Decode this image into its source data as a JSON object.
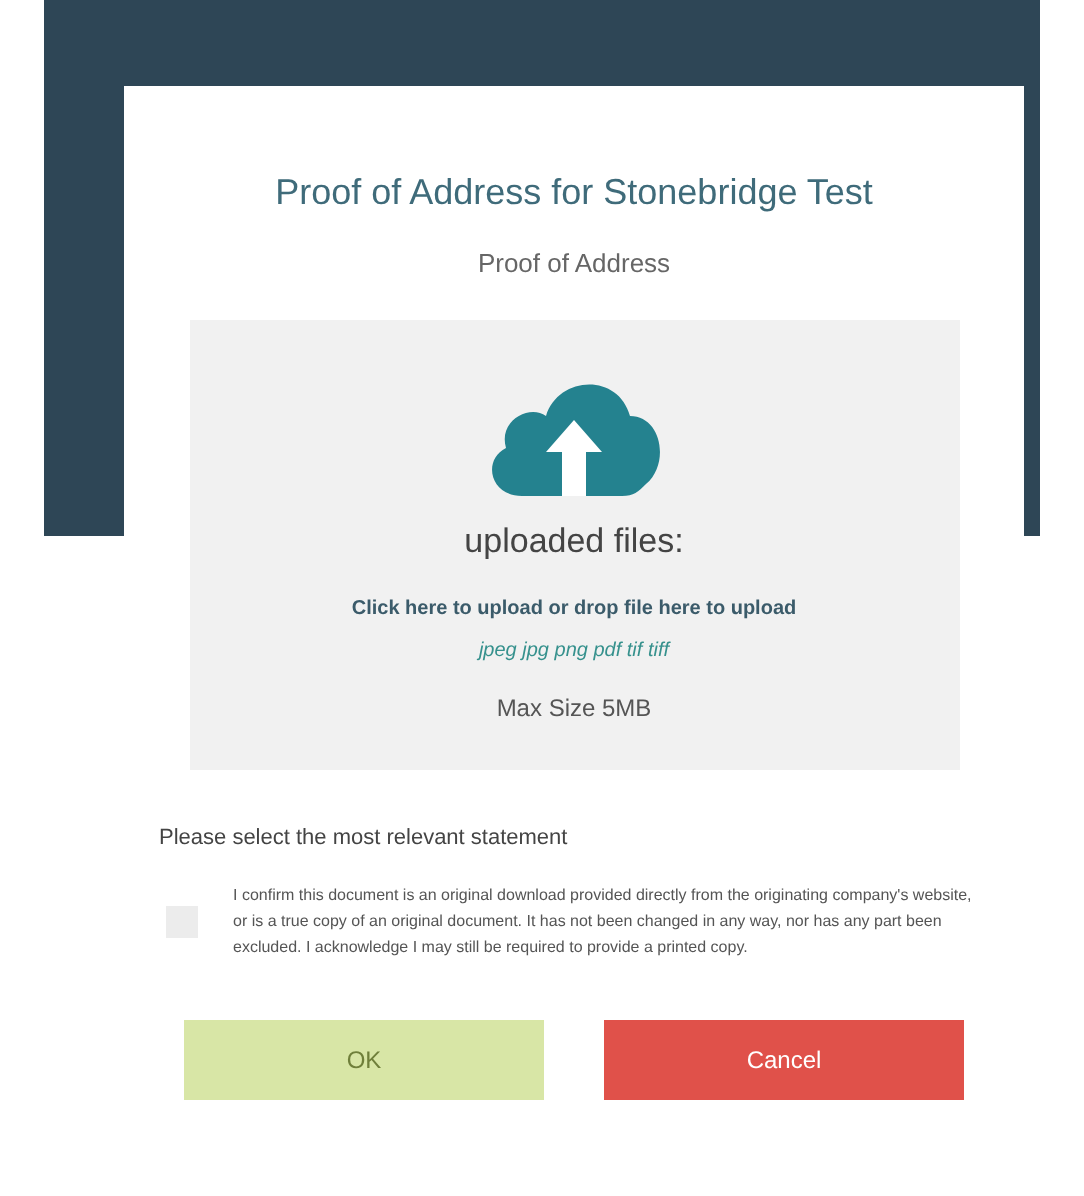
{
  "dialog": {
    "title": "Proof of Address for Stonebridge Test",
    "subtitle": "Proof of Address"
  },
  "dropzone": {
    "heading": "uploaded files:",
    "instruction": "Click here to upload or drop file here to upload",
    "formats": "jpeg jpg png pdf tif tiff",
    "max_size": "Max Size 5MB"
  },
  "statement": {
    "prompt": "Please select the most relevant statement",
    "checked": false,
    "text": "I confirm this document is an original download provided directly from the originating company's website, or is a true copy of an original document. It has not been changed in any way, nor has any part been excluded. I acknowledge I may still be required to provide a printed copy."
  },
  "buttons": [
    {
      "kind": "confirm",
      "label": "OK",
      "disabled": true
    },
    {
      "kind": "cancel",
      "label": "Cancel",
      "disabled": false
    }
  ]
}
